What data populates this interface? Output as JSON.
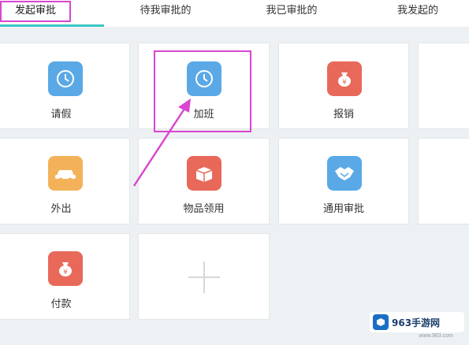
{
  "tabs": [
    {
      "label": "发起审批",
      "active": true
    },
    {
      "label": "待我审批的",
      "active": false
    },
    {
      "label": "我已审批的",
      "active": false
    },
    {
      "label": "我发起的",
      "active": false
    }
  ],
  "apps": [
    {
      "label": "请假",
      "icon": "clock-icon",
      "color": "#5aa9e6"
    },
    {
      "label": "加班",
      "icon": "clock-icon",
      "color": "#5aa9e6"
    },
    {
      "label": "报销",
      "icon": "money-bag-icon",
      "color": "#e8695a"
    },
    {
      "label": "外出",
      "icon": "car-icon",
      "color": "#f3b25a"
    },
    {
      "label": "物品领用",
      "icon": "box-icon",
      "color": "#e8695a"
    },
    {
      "label": "通用审批",
      "icon": "handshake-icon",
      "color": "#5aa9e6"
    },
    {
      "label": "付款",
      "icon": "money-bag-icon",
      "color": "#e8695a"
    }
  ],
  "add_button": {
    "icon": "plus-icon"
  },
  "watermark": {
    "brand": "963手游网",
    "site": "www.963.com"
  }
}
